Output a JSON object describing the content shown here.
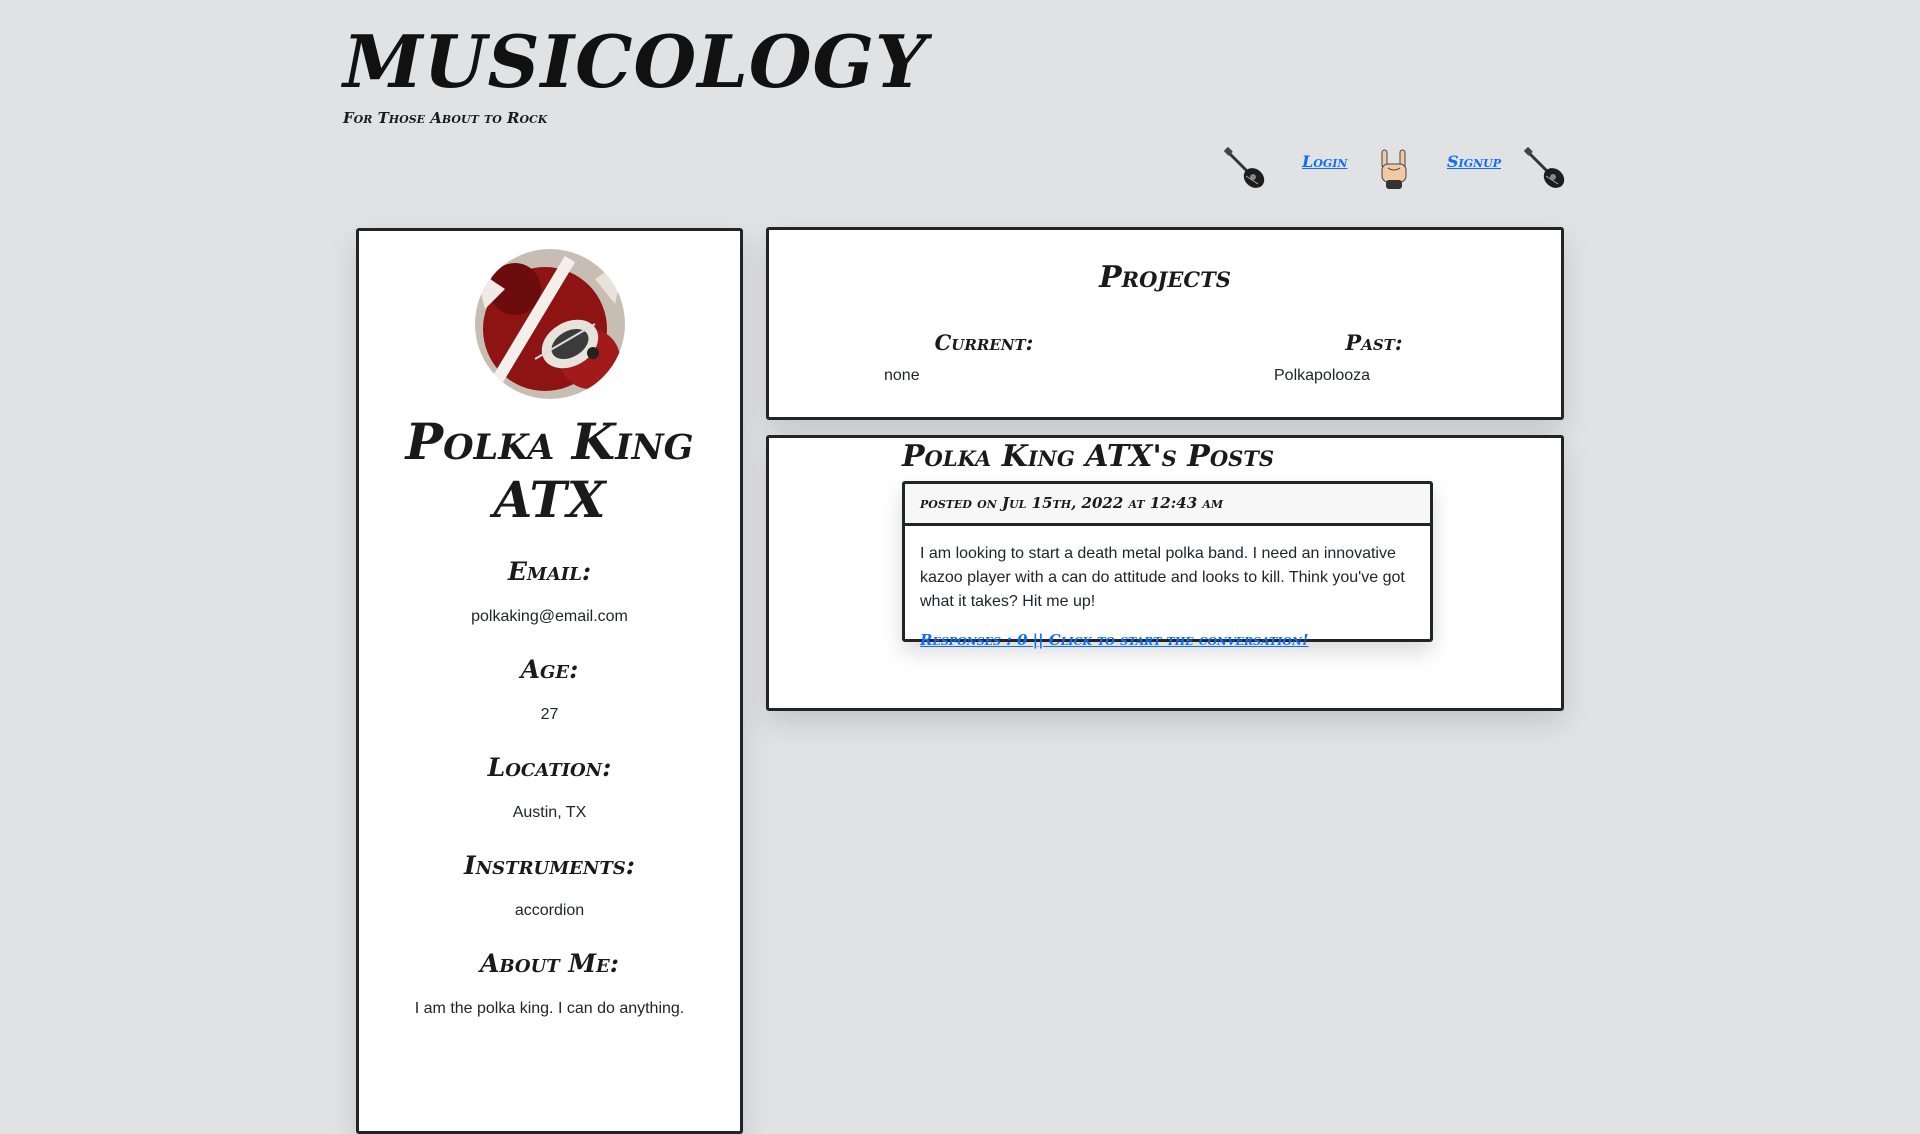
{
  "header": {
    "title": "MUSICOLOGY",
    "tagline": "For Those About to Rock"
  },
  "nav": {
    "login": "Login",
    "signup": "Signup",
    "icons": [
      "guitar-icon",
      "rock-hand-icon",
      "guitar-icon"
    ]
  },
  "profile": {
    "name": "Polka King ATX",
    "email_label": "Email:",
    "email": "polkaking@email.com",
    "age_label": "Age:",
    "age": "27",
    "location_label": "Location:",
    "location": "Austin, TX",
    "instruments_label": "Instruments:",
    "instruments": "accordion",
    "about_label": "About Me:",
    "about": "I am the polka king. I can do anything."
  },
  "projects": {
    "title": "Projects",
    "current_label": "Current:",
    "current": "none",
    "past_label": "Past:",
    "past": "Polkapolooza"
  },
  "posts": {
    "title": "Polka King ATX's Posts",
    "items": [
      {
        "posted": "posted on Jul 15th, 2022 at 12:43 am",
        "body": "I am looking to start a death metal polka band. I need an innovative kazoo player with a can do attitude and looks to kill. Think you've got what it takes? Hit me up!",
        "responses": "Responses : 0 || Click to start the conversation!"
      }
    ]
  },
  "colors": {
    "background": "#e1e2e4",
    "link": "#0d6efd",
    "border": "#212529"
  }
}
